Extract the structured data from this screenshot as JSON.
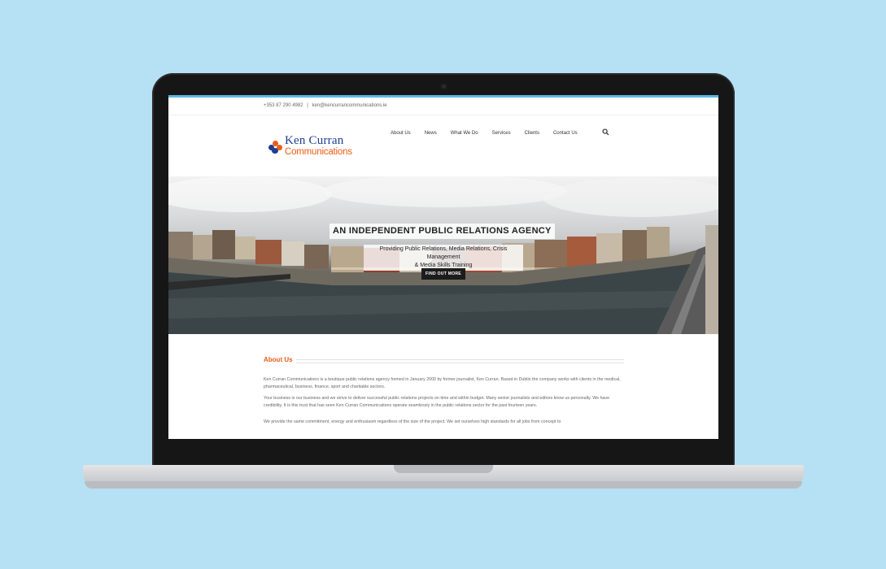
{
  "contact": {
    "phone": "+353 87 290 4982",
    "separator": "|",
    "email": "ken@kencurrancommunications.ie"
  },
  "logo": {
    "line1": "Ken Curran",
    "line2": "Communications"
  },
  "nav": {
    "items": [
      "About Us",
      "News",
      "What We Do",
      "Services",
      "Clients",
      "Contact Us"
    ]
  },
  "hero": {
    "title": "AN INDEPENDENT PUBLIC RELATIONS AGENCY",
    "subtitle_line1": "Providing Public Relations, Media Relations, Crisis Management",
    "subtitle_line2": "& Media Skills Training",
    "button": "FIND OUT MORE"
  },
  "about": {
    "heading": "About Us",
    "paragraphs": [
      "Ken Curran Communications is a boutique public relations agency formed in January 2000 by former  journalist, Ken Curran.  Based in Dublin the company works with clients in the medical, pharmaceutical, business, finance, sport and charitable sectors.",
      "Your business is our business and we strive to deliver successful public relations projects on time and within budget. Many senior journalists and editors know us personally.  We have credibility. It is this trust that has seen Ken Curran Communications operate seamlessly in the public relations sector for the past fourteen years.",
      "We provide the same commitment, energy and enthusiasm regardless of the size of the project.  We set ourselves high standards for all jobs from concept to"
    ]
  },
  "colors": {
    "background": "#b6e0f4",
    "accent_orange": "#e85d16",
    "logo_blue": "#1d3f8f",
    "top_line": "#5ab9e6"
  },
  "icons": {
    "search": "search-icon",
    "logo_mark": "people-group-icon",
    "camera": "camera-icon"
  }
}
